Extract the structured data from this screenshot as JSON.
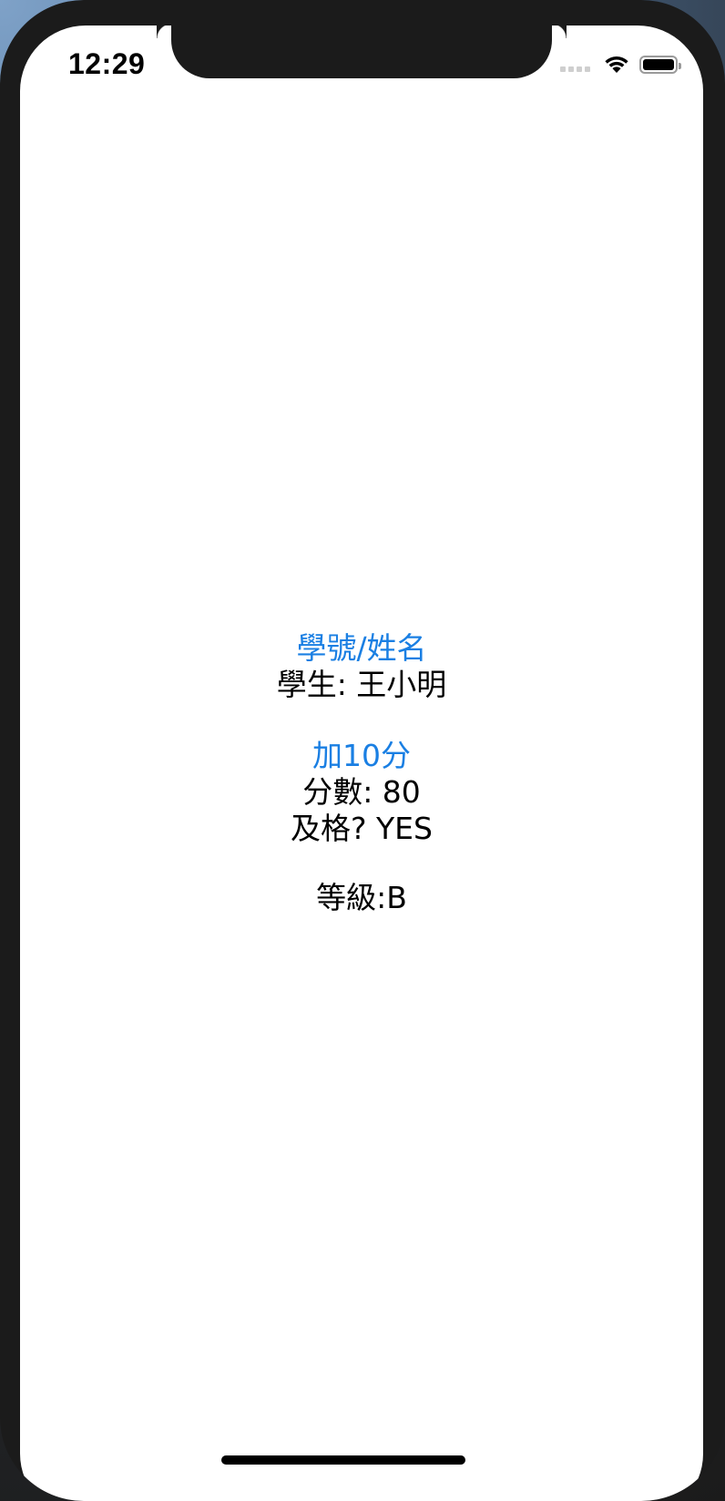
{
  "status_bar": {
    "time": "12:29",
    "signal_icon": "cellular-signal-icon",
    "wifi_icon": "wifi-icon",
    "battery_icon": "battery-icon",
    "battery_level": 1.0
  },
  "main": {
    "id_name_button": "學號/姓名",
    "student_label": "學生: 王小明",
    "add_points_button": "加10分",
    "score_label": "分數: 80",
    "pass_label": "及格? YES",
    "grade_label": "等級:B"
  },
  "colors": {
    "link_blue": "#1a7fe3",
    "text_black": "#000000",
    "bezel": "#1b1b1b"
  }
}
